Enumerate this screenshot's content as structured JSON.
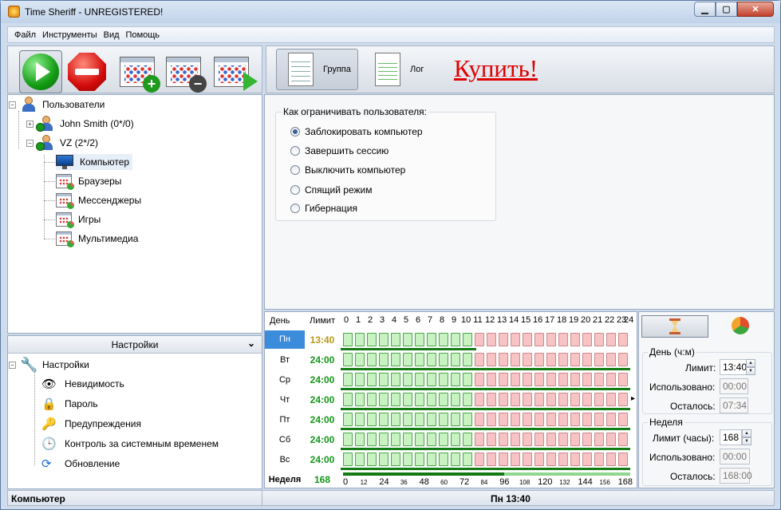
{
  "window": {
    "title": "Time Sheriff - UNREGISTERED!",
    "min": "▁",
    "max": "▢",
    "close": "✕"
  },
  "menu": [
    "Файл",
    "Инструменты",
    "Вид",
    "Помощь"
  ],
  "tabs": {
    "group": "Группа",
    "log": "Лог",
    "buy": "Купить!"
  },
  "tree": {
    "root": "Пользователи",
    "user1": "John Smith (0*/0)",
    "user2": "VZ (2*/2)",
    "items": [
      "Компьютер",
      "Браузеры",
      "Мессенджеры",
      "Игры",
      "Мультимедиа"
    ]
  },
  "settings": {
    "header": "Настройки",
    "root": "Настройки",
    "items": [
      "Невидимость",
      "Пароль",
      "Предупреждения",
      "Контроль за системным временем",
      "Обновление"
    ]
  },
  "restrict": {
    "legend": "Как ограничивать пользователя:",
    "options": [
      "Заблокировать компьютер",
      "Завершить сессию",
      "Выключить компьютер",
      "Спящий режим",
      "Гибернация"
    ],
    "selected": 0
  },
  "schedule": {
    "day_header": "День",
    "limit_header": "Лимит",
    "hours": [
      "0",
      "1",
      "2",
      "3",
      "4",
      "5",
      "6",
      "7",
      "8",
      "9",
      "10",
      "11",
      "12",
      "13",
      "14",
      "15",
      "16",
      "17",
      "18",
      "19",
      "20",
      "21",
      "22",
      "23",
      "24"
    ],
    "days": [
      {
        "day": "Пн",
        "limit": "13:40",
        "selected": true
      },
      {
        "day": "Вт",
        "limit": "24:00"
      },
      {
        "day": "Ср",
        "limit": "24:00"
      },
      {
        "day": "Чт",
        "limit": "24:00"
      },
      {
        "day": "Пт",
        "limit": "24:00"
      },
      {
        "day": "Сб",
        "limit": "24:00"
      },
      {
        "day": "Вс",
        "limit": "24:00"
      }
    ],
    "week_label": "Неделя",
    "week_limit": "168",
    "week_ticks": [
      "0",
      "12",
      "24",
      "36",
      "48",
      "60",
      "72",
      "84",
      "96",
      "108",
      "120",
      "132",
      "144",
      "156",
      "168"
    ],
    "week_progress": 0.56,
    "red_hours": [
      11,
      12,
      13,
      14,
      15,
      16,
      17,
      18,
      19,
      20,
      21,
      22,
      23
    ]
  },
  "day_panel": {
    "title": "День (ч:м)",
    "limit_label": "Лимит:",
    "limit": "13:40",
    "used_label": "Использовано:",
    "used": "00:00",
    "left_label": "Осталось:",
    "left": "07:34"
  },
  "week_panel": {
    "title": "Неделя",
    "limit_label": "Лимит (часы):",
    "limit": "168",
    "used_label": "Использовано:",
    "used": "00:00",
    "left_label": "Осталось:",
    "left": "168:00"
  },
  "status": {
    "left": "Компьютер",
    "center": "Пн 13:40"
  }
}
